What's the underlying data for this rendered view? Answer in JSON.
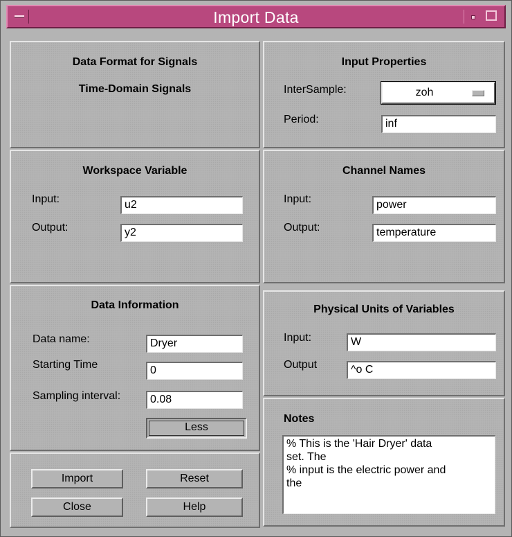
{
  "window": {
    "title": "Import Data"
  },
  "data_format": {
    "title": "Data Format for Signals",
    "value": "Time-Domain Signals"
  },
  "input_properties": {
    "title": "Input Properties",
    "intersample_label": "InterSample:",
    "intersample_value": "zoh",
    "period_label": "Period:",
    "period_value": "inf"
  },
  "workspace_variable": {
    "title": "Workspace Variable",
    "input_label": "Input:",
    "input_value": "u2",
    "output_label": "Output:",
    "output_value": "y2"
  },
  "channel_names": {
    "title": "Channel Names",
    "input_label": "Input:",
    "input_value": "power",
    "output_label": "Output:",
    "output_value": "temperature"
  },
  "data_information": {
    "title": "Data Information",
    "name_label": "Data name:",
    "name_value": "Dryer",
    "start_label": "Starting Time",
    "start_value": "0",
    "interval_label": "Sampling interval:",
    "interval_value": "0.08",
    "less_label": "Less"
  },
  "physical_units": {
    "title": "Physical Units of Variables",
    "input_label": "Input:",
    "input_value": "W",
    "output_label": "Output",
    "output_value": "^o C"
  },
  "notes": {
    "title": "Notes",
    "text": "% This is the 'Hair Dryer' data\nset. The\n% input is the electric power and\nthe"
  },
  "actions": {
    "import": "Import",
    "reset": "Reset",
    "close": "Close",
    "help": "Help"
  },
  "colors": {
    "titlebar": "#b8487e",
    "panel": "#b4b4b4",
    "field": "#ffffff"
  }
}
